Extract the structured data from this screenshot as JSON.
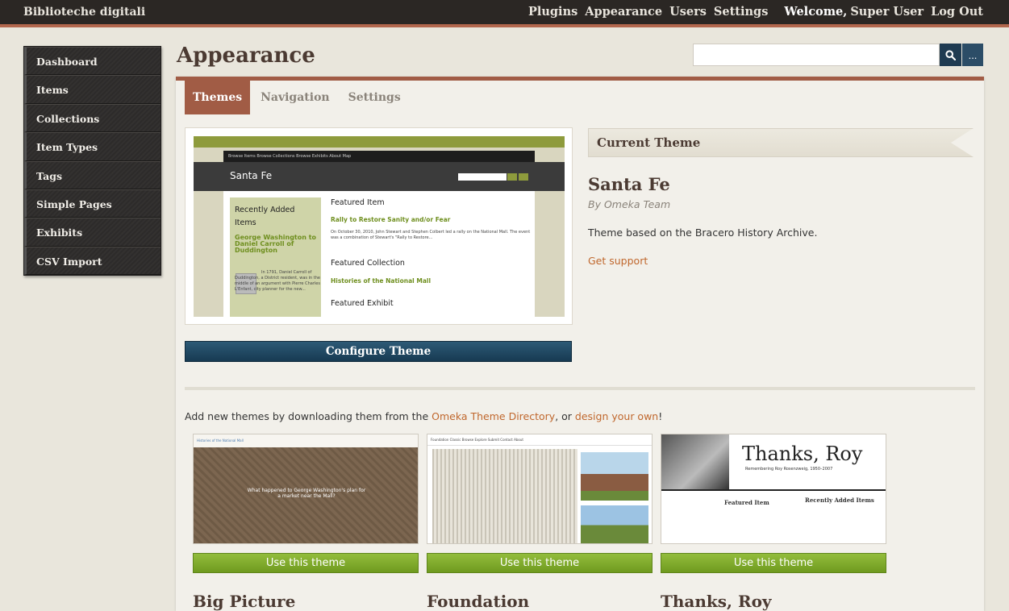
{
  "site": {
    "title": "Biblioteche digitali"
  },
  "global_nav": {
    "items": [
      "Plugins",
      "Appearance",
      "Users",
      "Settings"
    ],
    "welcome": "Welcome,",
    "user": "Super User",
    "logout": "Log Out"
  },
  "sidebar": {
    "items": [
      {
        "label": "Dashboard"
      },
      {
        "label": "Items"
      },
      {
        "label": "Collections"
      },
      {
        "label": "Item Types"
      },
      {
        "label": "Tags"
      },
      {
        "label": "Simple Pages"
      },
      {
        "label": "Exhibits"
      },
      {
        "label": "CSV Import"
      }
    ]
  },
  "page": {
    "title": "Appearance"
  },
  "search": {
    "placeholder": "",
    "more_label": "..."
  },
  "tabs": [
    {
      "label": "Themes",
      "active": true
    },
    {
      "label": "Navigation",
      "active": false
    },
    {
      "label": "Settings",
      "active": false
    }
  ],
  "current_theme": {
    "section_label": "Current Theme",
    "name": "Santa Fe",
    "author": "By Omeka Team",
    "description": "Theme based on the Bracero History Archive.",
    "support_link": "Get support",
    "configure_label": "Configure Theme",
    "preview": {
      "nav_text": "Browse Items    Browse Collections    Browse Exhibits    About    Map",
      "site_title": "Santa Fe",
      "recently_added": "Recently Added Items",
      "recent_item": "George Washington to Daniel Carroll of Duddington",
      "recent_desc": "In 1791, Daniel Carroll of Duddington, a District resident, was in the middle of an argument with Pierre Charles L'Enfant, city planner for the new...",
      "featured_item_label": "Featured Item",
      "featured_item": "Rally to Restore Sanity and/or Fear",
      "featured_item_desc": "On October 30, 2010, John Stewart and Stephen Colbert led a rally on the National Mall. The event was a combination of Stewart's \"Rally to Restore...",
      "featured_collection_label": "Featured Collection",
      "featured_collection": "Histories of the National Mall",
      "featured_exhibit_label": "Featured Exhibit"
    }
  },
  "add_themes": {
    "prefix": "Add new themes by downloading them from the ",
    "directory_link": "Omeka Theme Directory",
    "middle": ", or ",
    "design_link": "design your own",
    "suffix": "!"
  },
  "themes": [
    {
      "name": "Big Picture",
      "button": "Use this theme",
      "shot_header": "Histories of the National Mall",
      "shot_caption": "What happened to George Washington's plan for a market near the Mall?"
    },
    {
      "name": "Foundation",
      "button": "Use this theme",
      "shot_header": "Foundation Classic        Browse   Explore   Submit   Contact   About"
    },
    {
      "name": "Thanks, Roy",
      "button": "Use this theme",
      "shot_title": "Thanks, Roy",
      "shot_sub": "Remembering Roy Rosenzweig, 1950–2007",
      "shot_featured": "Featured Item",
      "shot_recent": "Recently Added Items"
    }
  ],
  "colors": {
    "accent": "#a15c45",
    "topbar": "#2b2724",
    "primary_button": "#1f3b52",
    "use_button": "#7da92b",
    "link": "#c0672d"
  }
}
